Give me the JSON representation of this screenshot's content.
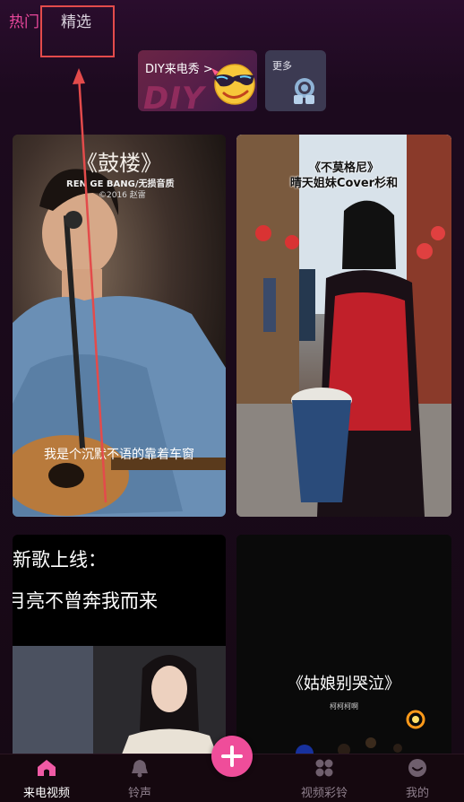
{
  "top_tabs": {
    "hot": "热门",
    "picked": "精选"
  },
  "diy_banner": {
    "label": "DIY来电秀 >",
    "watermark": "DIY"
  },
  "more_card": {
    "label": "更多"
  },
  "videos": [
    {
      "title": "《鼓楼》",
      "subtitle": "REN GE BANG/无损音质",
      "year": "©2016 赵雷",
      "lyric": "我是个沉默不语的靠着车窗"
    },
    {
      "title": "《不莫格尼》",
      "subtitle": "晴天姐妹Cover杉和"
    },
    {
      "line1": "新歌上线：",
      "line2": "月亮不曾奔我而来"
    },
    {
      "title": "《姑娘别哭泣》",
      "subtitle": "柯柯柯啊"
    }
  ],
  "bottom_nav": {
    "items": [
      {
        "label": "来电视频",
        "icon": "home-icon",
        "active": true
      },
      {
        "label": "铃声",
        "icon": "bell-icon",
        "active": false
      },
      {
        "label": "视频彩铃",
        "icon": "grid-icon",
        "active": false
      },
      {
        "label": "我的",
        "icon": "smile-icon",
        "active": false
      }
    ],
    "add_icon": "plus-icon"
  },
  "colors": {
    "accent": "#e8479b",
    "annotation": "#e34b4b",
    "add_button": "#ef4d9a"
  }
}
